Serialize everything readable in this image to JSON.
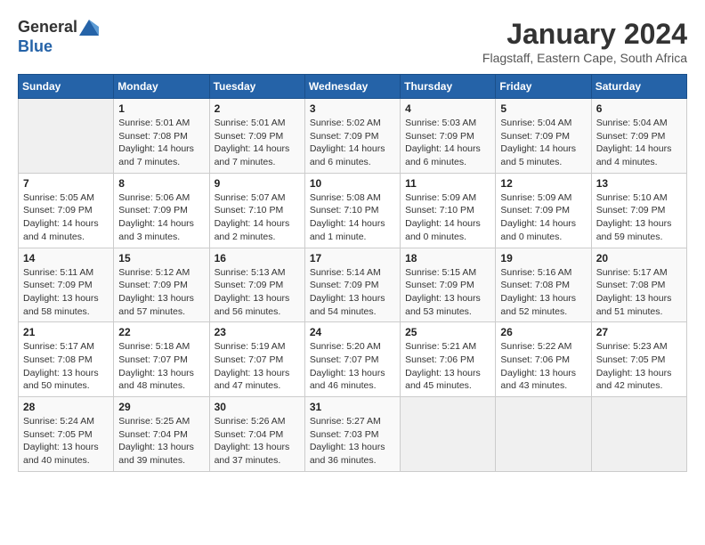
{
  "header": {
    "logo_line1": "General",
    "logo_line2": "Blue",
    "month": "January 2024",
    "location": "Flagstaff, Eastern Cape, South Africa"
  },
  "days_of_week": [
    "Sunday",
    "Monday",
    "Tuesday",
    "Wednesday",
    "Thursday",
    "Friday",
    "Saturday"
  ],
  "weeks": [
    [
      {
        "day": "",
        "sunrise": "",
        "sunset": "",
        "daylight": "",
        "empty": true
      },
      {
        "day": "1",
        "sunrise": "Sunrise: 5:01 AM",
        "sunset": "Sunset: 7:08 PM",
        "daylight": "Daylight: 14 hours and 7 minutes."
      },
      {
        "day": "2",
        "sunrise": "Sunrise: 5:01 AM",
        "sunset": "Sunset: 7:09 PM",
        "daylight": "Daylight: 14 hours and 7 minutes."
      },
      {
        "day": "3",
        "sunrise": "Sunrise: 5:02 AM",
        "sunset": "Sunset: 7:09 PM",
        "daylight": "Daylight: 14 hours and 6 minutes."
      },
      {
        "day": "4",
        "sunrise": "Sunrise: 5:03 AM",
        "sunset": "Sunset: 7:09 PM",
        "daylight": "Daylight: 14 hours and 6 minutes."
      },
      {
        "day": "5",
        "sunrise": "Sunrise: 5:04 AM",
        "sunset": "Sunset: 7:09 PM",
        "daylight": "Daylight: 14 hours and 5 minutes."
      },
      {
        "day": "6",
        "sunrise": "Sunrise: 5:04 AM",
        "sunset": "Sunset: 7:09 PM",
        "daylight": "Daylight: 14 hours and 4 minutes."
      }
    ],
    [
      {
        "day": "7",
        "sunrise": "Sunrise: 5:05 AM",
        "sunset": "Sunset: 7:09 PM",
        "daylight": "Daylight: 14 hours and 4 minutes."
      },
      {
        "day": "8",
        "sunrise": "Sunrise: 5:06 AM",
        "sunset": "Sunset: 7:09 PM",
        "daylight": "Daylight: 14 hours and 3 minutes."
      },
      {
        "day": "9",
        "sunrise": "Sunrise: 5:07 AM",
        "sunset": "Sunset: 7:10 PM",
        "daylight": "Daylight: 14 hours and 2 minutes."
      },
      {
        "day": "10",
        "sunrise": "Sunrise: 5:08 AM",
        "sunset": "Sunset: 7:10 PM",
        "daylight": "Daylight: 14 hours and 1 minute."
      },
      {
        "day": "11",
        "sunrise": "Sunrise: 5:09 AM",
        "sunset": "Sunset: 7:10 PM",
        "daylight": "Daylight: 14 hours and 0 minutes."
      },
      {
        "day": "12",
        "sunrise": "Sunrise: 5:09 AM",
        "sunset": "Sunset: 7:09 PM",
        "daylight": "Daylight: 14 hours and 0 minutes."
      },
      {
        "day": "13",
        "sunrise": "Sunrise: 5:10 AM",
        "sunset": "Sunset: 7:09 PM",
        "daylight": "Daylight: 13 hours and 59 minutes."
      }
    ],
    [
      {
        "day": "14",
        "sunrise": "Sunrise: 5:11 AM",
        "sunset": "Sunset: 7:09 PM",
        "daylight": "Daylight: 13 hours and 58 minutes."
      },
      {
        "day": "15",
        "sunrise": "Sunrise: 5:12 AM",
        "sunset": "Sunset: 7:09 PM",
        "daylight": "Daylight: 13 hours and 57 minutes."
      },
      {
        "day": "16",
        "sunrise": "Sunrise: 5:13 AM",
        "sunset": "Sunset: 7:09 PM",
        "daylight": "Daylight: 13 hours and 56 minutes."
      },
      {
        "day": "17",
        "sunrise": "Sunrise: 5:14 AM",
        "sunset": "Sunset: 7:09 PM",
        "daylight": "Daylight: 13 hours and 54 minutes."
      },
      {
        "day": "18",
        "sunrise": "Sunrise: 5:15 AM",
        "sunset": "Sunset: 7:09 PM",
        "daylight": "Daylight: 13 hours and 53 minutes."
      },
      {
        "day": "19",
        "sunrise": "Sunrise: 5:16 AM",
        "sunset": "Sunset: 7:08 PM",
        "daylight": "Daylight: 13 hours and 52 minutes."
      },
      {
        "day": "20",
        "sunrise": "Sunrise: 5:17 AM",
        "sunset": "Sunset: 7:08 PM",
        "daylight": "Daylight: 13 hours and 51 minutes."
      }
    ],
    [
      {
        "day": "21",
        "sunrise": "Sunrise: 5:17 AM",
        "sunset": "Sunset: 7:08 PM",
        "daylight": "Daylight: 13 hours and 50 minutes."
      },
      {
        "day": "22",
        "sunrise": "Sunrise: 5:18 AM",
        "sunset": "Sunset: 7:07 PM",
        "daylight": "Daylight: 13 hours and 48 minutes."
      },
      {
        "day": "23",
        "sunrise": "Sunrise: 5:19 AM",
        "sunset": "Sunset: 7:07 PM",
        "daylight": "Daylight: 13 hours and 47 minutes."
      },
      {
        "day": "24",
        "sunrise": "Sunrise: 5:20 AM",
        "sunset": "Sunset: 7:07 PM",
        "daylight": "Daylight: 13 hours and 46 minutes."
      },
      {
        "day": "25",
        "sunrise": "Sunrise: 5:21 AM",
        "sunset": "Sunset: 7:06 PM",
        "daylight": "Daylight: 13 hours and 45 minutes."
      },
      {
        "day": "26",
        "sunrise": "Sunrise: 5:22 AM",
        "sunset": "Sunset: 7:06 PM",
        "daylight": "Daylight: 13 hours and 43 minutes."
      },
      {
        "day": "27",
        "sunrise": "Sunrise: 5:23 AM",
        "sunset": "Sunset: 7:05 PM",
        "daylight": "Daylight: 13 hours and 42 minutes."
      }
    ],
    [
      {
        "day": "28",
        "sunrise": "Sunrise: 5:24 AM",
        "sunset": "Sunset: 7:05 PM",
        "daylight": "Daylight: 13 hours and 40 minutes."
      },
      {
        "day": "29",
        "sunrise": "Sunrise: 5:25 AM",
        "sunset": "Sunset: 7:04 PM",
        "daylight": "Daylight: 13 hours and 39 minutes."
      },
      {
        "day": "30",
        "sunrise": "Sunrise: 5:26 AM",
        "sunset": "Sunset: 7:04 PM",
        "daylight": "Daylight: 13 hours and 37 minutes."
      },
      {
        "day": "31",
        "sunrise": "Sunrise: 5:27 AM",
        "sunset": "Sunset: 7:03 PM",
        "daylight": "Daylight: 13 hours and 36 minutes."
      },
      {
        "day": "",
        "sunrise": "",
        "sunset": "",
        "daylight": "",
        "empty": true
      },
      {
        "day": "",
        "sunrise": "",
        "sunset": "",
        "daylight": "",
        "empty": true
      },
      {
        "day": "",
        "sunrise": "",
        "sunset": "",
        "daylight": "",
        "empty": true
      }
    ]
  ]
}
